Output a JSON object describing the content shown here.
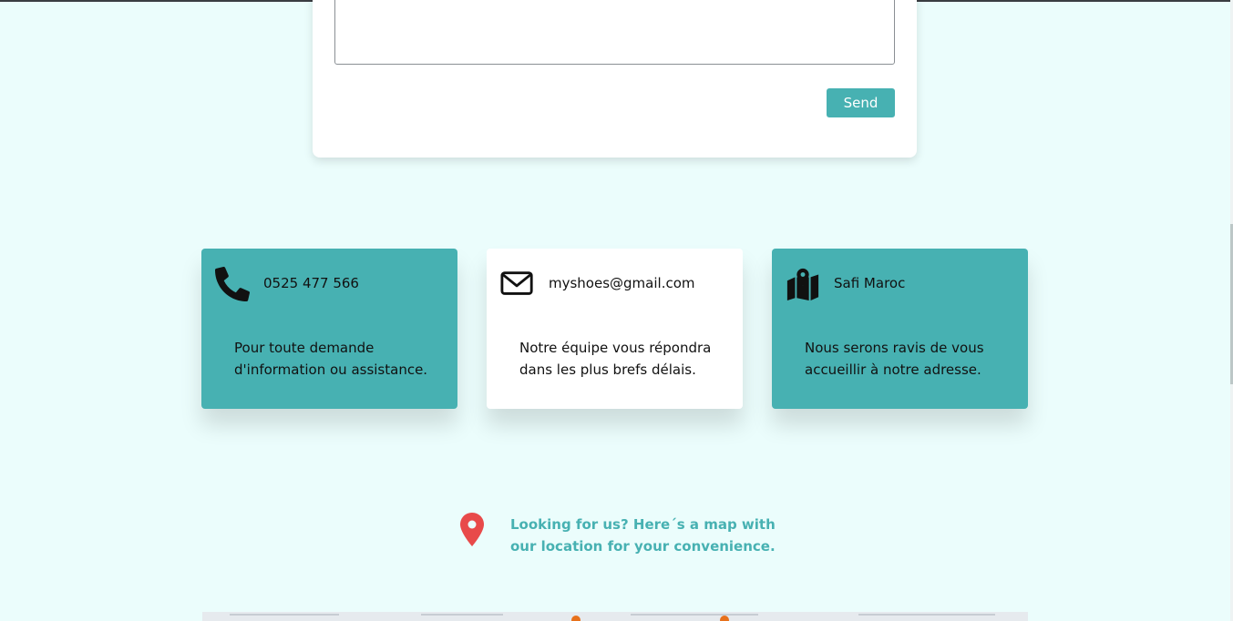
{
  "contact_form": {
    "send_label": "Send"
  },
  "info_cards": [
    {
      "icon": "phone-icon",
      "title": "0525 477 566",
      "text": "Pour toute demande d'information ou assistance."
    },
    {
      "icon": "envelope-icon",
      "title": "myshoes@gmail.com",
      "text": "Notre équipe vous répondra dans les plus brefs délais."
    },
    {
      "icon": "map-pin-icon",
      "title": "Safi Maroc",
      "text": "Nous serons ravis de vous accueillir à notre adresse."
    }
  ],
  "map_note": {
    "icon": "location-pin-icon",
    "text": "Looking for us? Here´s a map with our location for your convenience."
  },
  "colors": {
    "accent": "#47b1b2",
    "background": "#ebfdfc",
    "pin": "#e84a4a"
  }
}
